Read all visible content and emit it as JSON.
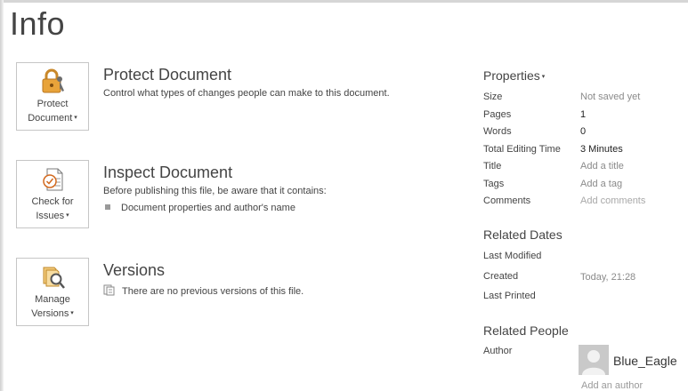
{
  "page": {
    "title": "Info"
  },
  "protect": {
    "button_line1": "Protect",
    "button_line2": "Document",
    "title": "Protect Document",
    "description": "Control what types of changes people can make to this document."
  },
  "inspect": {
    "button_line1": "Check for",
    "button_line2": "Issues",
    "title": "Inspect Document",
    "description": "Before publishing this file, be aware that it contains:",
    "bullet": "Document properties and author's name"
  },
  "versions": {
    "button_line1": "Manage",
    "button_line2": "Versions",
    "title": "Versions",
    "description": "There are no previous versions of this file."
  },
  "properties": {
    "header": "Properties",
    "size_label": "Size",
    "size_value": "Not saved yet",
    "pages_label": "Pages",
    "pages_value": "1",
    "words_label": "Words",
    "words_value": "0",
    "editing_label": "Total Editing Time",
    "editing_value": "3 Minutes",
    "title_label": "Title",
    "title_value": "Add a title",
    "tags_label": "Tags",
    "tags_value": "Add a tag",
    "comments_label": "Comments",
    "comments_value": "Add comments"
  },
  "related_dates": {
    "heading": "Related Dates",
    "last_modified_label": "Last Modified",
    "created_label": "Created",
    "created_value": "Today, 21:28",
    "last_printed_label": "Last Printed"
  },
  "related_people": {
    "heading": "Related People",
    "author_label": "Author",
    "author_name": "Blue_Eagle",
    "add_author": "Add an author"
  },
  "icons": {
    "protect": "lock-key-icon",
    "inspect": "document-check-icon",
    "versions": "document-magnifier-icon",
    "avatar": "person-avatar-icon"
  }
}
